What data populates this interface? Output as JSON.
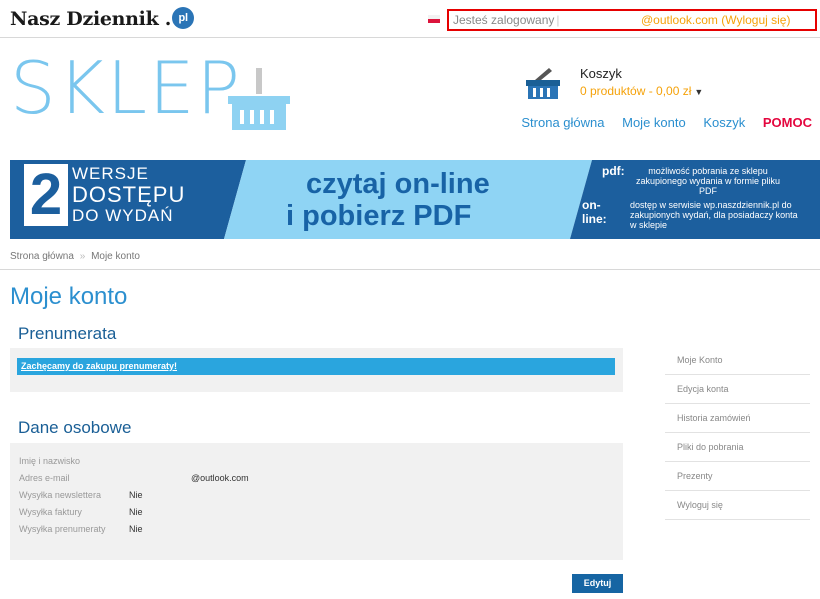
{
  "topbar": {
    "logo_text": "Nasz Dziennik",
    "logo_dot": ".",
    "logo_badge": "pl",
    "login_prefix": "Jesteś zalogowany",
    "login_email": "@outlook.com",
    "login_paren_open": "(",
    "logout_label": "Wyloguj się",
    "login_paren_close": ")"
  },
  "shop": {
    "title": "SKLEP",
    "cart_title": "Koszyk",
    "cart_summary": "0 produktów - 0,00 zł",
    "nav": [
      "Strona główna",
      "Moje konto",
      "Koszyk",
      "POMOC"
    ]
  },
  "banner": {
    "number": "2",
    "line1": "WERSJE",
    "line2": "DOSTĘPU",
    "line3": "DO WYDAŃ",
    "mid1": "czytaj on-line",
    "mid2": "i pobierz PDF",
    "pdf_key": "pdf:",
    "pdf_text": "możliwość pobrania ze sklepu zakupionego wydania w formie pliku PDF",
    "online_key": "on-line:",
    "online_text": "dostęp w serwisie wp.naszdziennik.pl do zakupionych wydań, dla posiadaczy konta w sklepie"
  },
  "breadcrumb": {
    "home": "Strona główna",
    "separator": "»",
    "current": "Moje konto"
  },
  "page_title": "Moje konto",
  "subscription": {
    "heading": "Prenumerata",
    "promo_link": "Zachęcamy do zakupu prenumeraty!"
  },
  "personal": {
    "heading": "Dane osobowe",
    "rows": [
      {
        "label": "Imię i nazwisko",
        "value": ""
      },
      {
        "label": "Adres e-mail",
        "value": "@outlook.com"
      },
      {
        "label": "Wysyłka newslettera",
        "value": "Nie"
      },
      {
        "label": "Wysyłka faktury",
        "value": "Nie"
      },
      {
        "label": "Wysyłka prenumeraty",
        "value": "Nie"
      }
    ],
    "edit_label": "Edytuj"
  },
  "sidebar": {
    "items": [
      "Moje Konto",
      "Edycja konta",
      "Historia zamówień",
      "Pliki do pobrania",
      "Prezenty",
      "Wyloguj się"
    ]
  },
  "colors": {
    "accent_blue": "#2b8fcf",
    "login_border": "#e60000",
    "orange": "#f5a20a",
    "help_red": "#e4063e",
    "button_blue": "#1665a3"
  }
}
